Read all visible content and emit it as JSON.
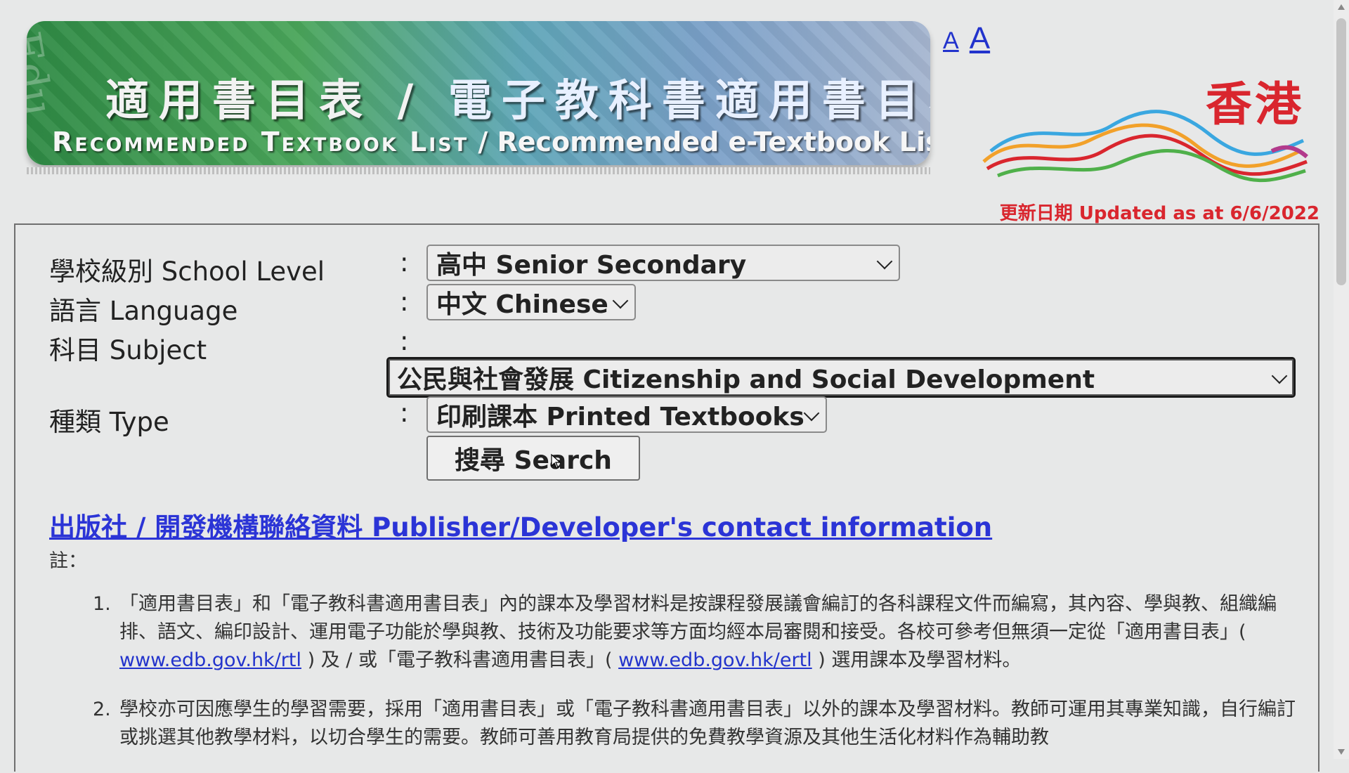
{
  "header": {
    "title_zh_part1": "適用書目表",
    "title_zh_sep": "/",
    "title_zh_part2": "電子教科書適用書目表",
    "title_en_part1": "Recommended Textbook List",
    "title_en_sep": "/",
    "title_en_part2": "Recommended e-Textbook List",
    "font_size_small": "A",
    "font_size_large": "A",
    "brand_text": "香港"
  },
  "updated": "更新日期 Updated as at 6/6/2022",
  "form": {
    "colon": ":",
    "school_level": {
      "label": "學校級別 School Level",
      "value": "高中 Senior Secondary"
    },
    "language": {
      "label": "語言 Language",
      "value": "中文 Chinese"
    },
    "subject": {
      "label": "科目 Subject",
      "value": "公民與社會發展 Citizenship and Social Development"
    },
    "type": {
      "label": "種類 Type",
      "value": "印刷課本 Printed Textbooks"
    },
    "search_label": "搜尋 Search"
  },
  "contact_link": "出版社 / 開發機構聯絡資料   Publisher/Developer's contact information",
  "notes": {
    "label": "註：",
    "items": [
      {
        "num": "1.",
        "text_a": "「適用書目表」和「電子教科書適用書目表」內的課本及學習材料是按課程發展議會編訂的各科課程文件而編寫，其內容、學與教、組織編排、語文、編印設計、運用電子功能於學與教、技術及功能要求等方面均經本局審閱和接受。各校可參考但無須一定從「適用書目表」(",
        "link1": "www.edb.gov.hk/rtl",
        "text_b": ") 及 / 或「電子教科書適用書目表」(",
        "link2": "www.edb.gov.hk/ertl",
        "text_c": ") 選用課本及學習材料。"
      },
      {
        "num": "2.",
        "text": "學校亦可因應學生的學習需要，採用「適用書目表」或「電子教科書適用書目表」以外的課本及學習材料。教師可運用其專業知識，自行編訂或挑選其他教學材料，以切合學生的需要。教師可善用教育局提供的免費教學資源及其他生活化材料作為輔助教"
      }
    ]
  },
  "colors": {
    "link": "#2b34d6",
    "updated": "#d9262e",
    "brand": "#d9262e"
  }
}
